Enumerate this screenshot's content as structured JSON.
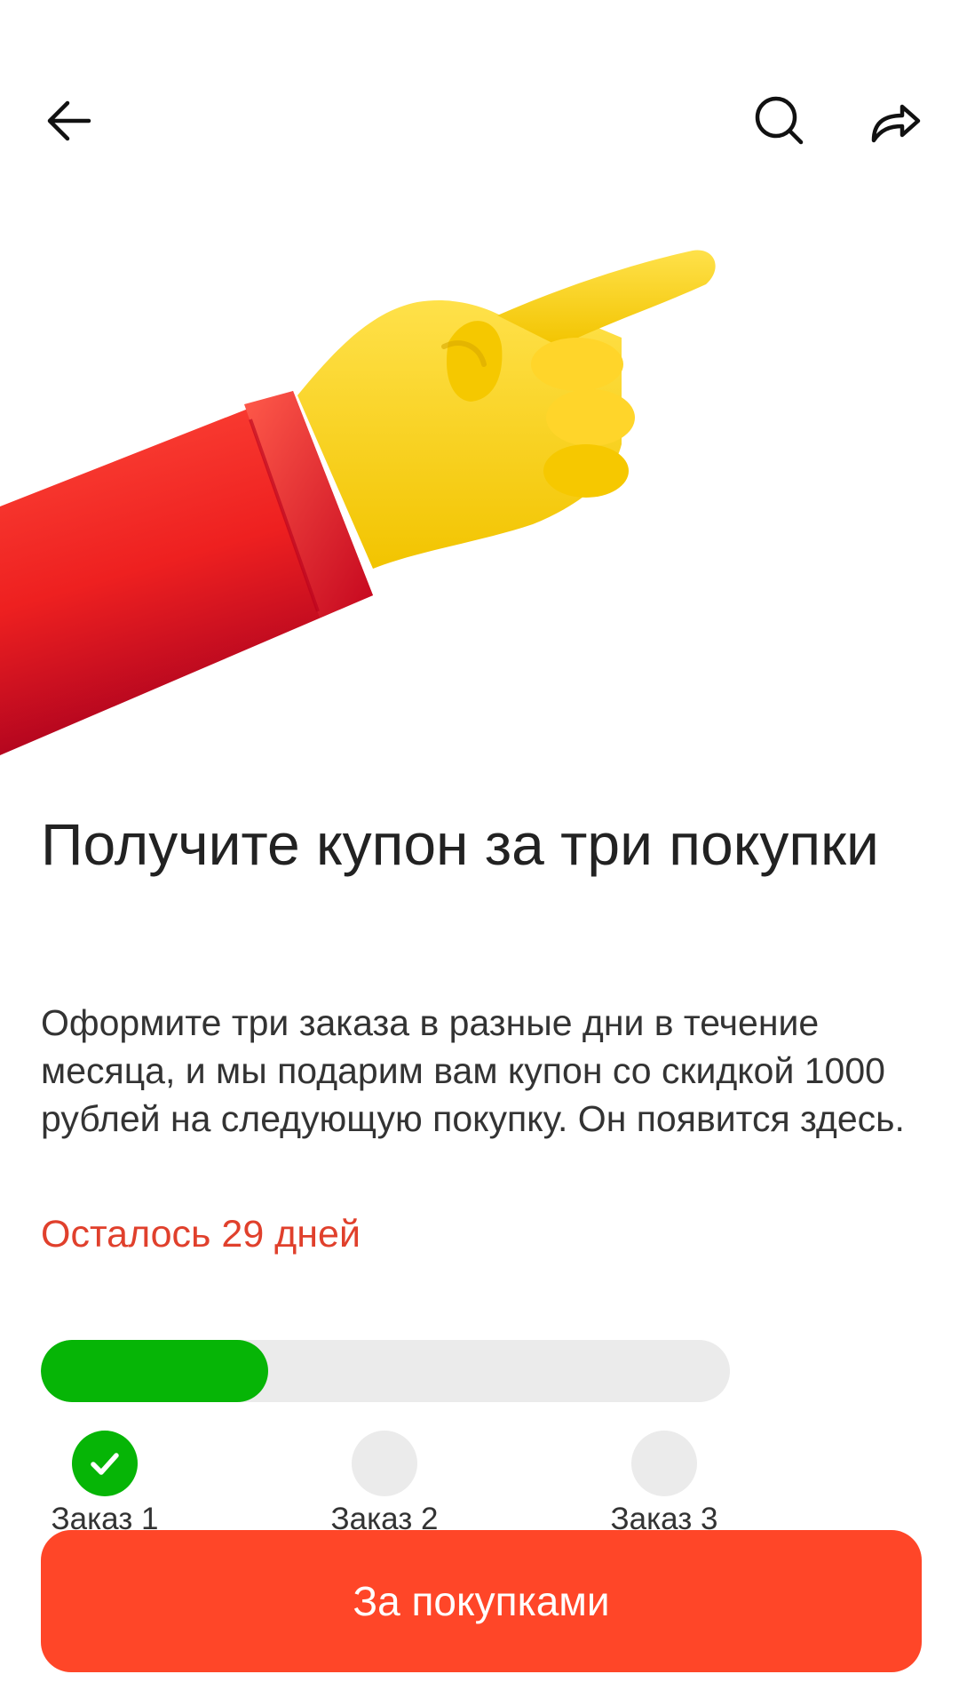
{
  "toolbar": {
    "back_icon": "arrow-left-icon",
    "search_icon": "search-icon",
    "share_icon": "share-arrow-icon"
  },
  "hero": {
    "illustration": "pointing-hand-illustration"
  },
  "promo": {
    "title": "Получите купон за три покупки",
    "description": "Оформите три заказа в разные дни в течение месяца, и мы подарим вам купон со скидкой 1000 рублей на следующую покупку. Он появится здесь.",
    "remaining": "Осталось 29 дней"
  },
  "progress": {
    "completed_orders": 1,
    "total_orders": 3,
    "fill_fraction": 0.33,
    "steps": [
      {
        "label": "Заказ 1",
        "done": true
      },
      {
        "label": "Заказ 2",
        "done": false
      },
      {
        "label": "Заказ 3",
        "done": false
      }
    ]
  },
  "cta": {
    "label": "За покупками"
  },
  "colors": {
    "accent": "#ff4628",
    "success": "#06b506",
    "remaining_text": "#e0402c",
    "track": "#ebebeb"
  }
}
